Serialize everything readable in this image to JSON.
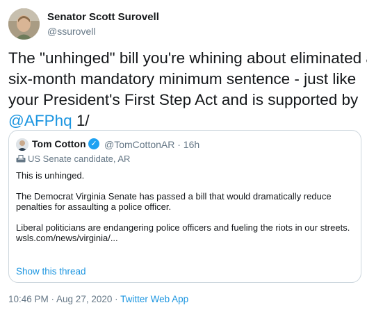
{
  "tweet": {
    "author": {
      "name": "Senator Scott Surovell",
      "handle": "@ssurovell"
    },
    "text_lines": [
      "The \"unhinged\" bill you're whining about eliminated a",
      "six-month mandatory minimum sentence - just like",
      "your President's First Step Act and is supported by"
    ],
    "mention": "@AFPhq",
    "tail": " 1/",
    "timestamp": "10:46 PM · Aug 27, 2020",
    "separator": " · ",
    "source": "Twitter Web App"
  },
  "quote": {
    "author_name": "Tom Cotton",
    "handle_time": "@TomCottonAR · 16h",
    "label": "US Senate candidate, AR",
    "paragraphs": [
      "This is unhinged.",
      "The Democrat Virginia Senate has passed a bill that would dramatically reduce penalties for assaulting a police officer.",
      "Liberal politicians are endangering police officers and fueling the riots in our streets."
    ],
    "link": "wsls.com/news/virginia/...",
    "show_thread": "Show this thread"
  },
  "colors": {
    "link": "#1b95e0",
    "muted": "#657786",
    "verified": "#1da1f2",
    "border": "#ccd6dd"
  }
}
